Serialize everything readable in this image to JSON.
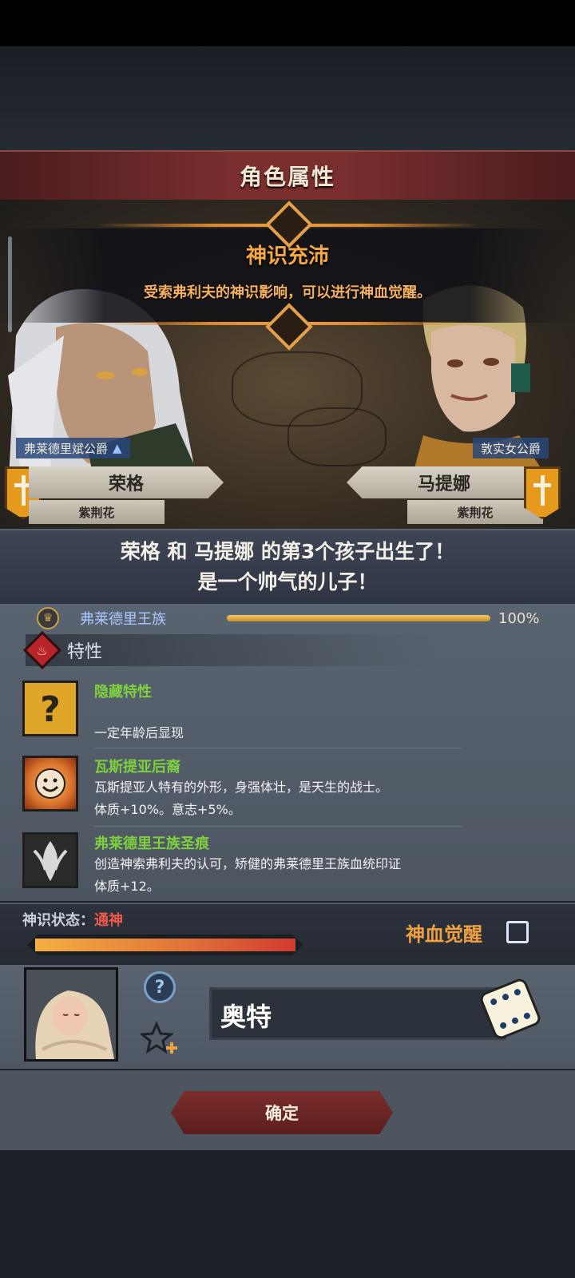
{
  "header": {
    "title": "角色属性"
  },
  "event": {
    "title": "神识充沛",
    "description": "受索弗利夫的神识影响，可以进行神血觉醒。"
  },
  "parents": {
    "father": {
      "title": "弗莱德里斌公爵",
      "name": "荣格",
      "house": "紫荆花"
    },
    "mother": {
      "title": "敦实女公爵",
      "name": "马提娜",
      "house": "紫荆花"
    }
  },
  "announcement": {
    "line1": "荣格 和 马提娜 的第3个孩子出生了！",
    "line2": "是一个帅气的儿子！"
  },
  "dynasty": {
    "name": "弗莱德里王族",
    "percent_text": "100%",
    "percent": 100
  },
  "traits": {
    "header": "特性",
    "items": [
      {
        "name": "隐藏特性",
        "desc1": "",
        "desc2": "一定年龄后显现",
        "icon": "question-mark-icon"
      },
      {
        "name": "瓦斯提亚后裔",
        "desc1": "瓦斯提亚人特有的外形，身强体壮，是天生的战士。",
        "desc2": "体质+10%。意志+5%。",
        "icon": "smiling-sun-icon"
      },
      {
        "name": "弗莱德里王族圣痕",
        "desc1": "创造神索弗利夫的认可，矫健的弗莱德里王族血统印证",
        "desc2": "体质+12。",
        "icon": "holy-mark-icon"
      }
    ]
  },
  "divine_status": {
    "label": "神识状态：",
    "value": "通神",
    "level": 1.0,
    "awaken_label": "神血觉醒",
    "awaken_checked": false
  },
  "child": {
    "name": "奥特"
  },
  "footer": {
    "confirm_label": "确定"
  },
  "colors": {
    "accent_gold": "#f5a844",
    "trait_green": "#7fd040",
    "status_red": "#f05a4a",
    "confirm_red": "#7a2e2c"
  }
}
